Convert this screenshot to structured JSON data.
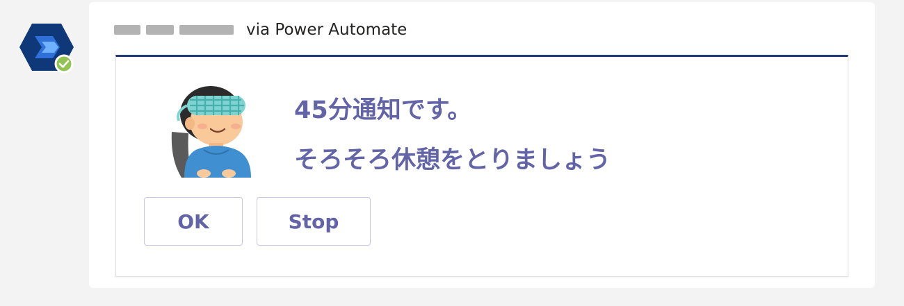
{
  "message": {
    "sender_suffix": "via Power Automate",
    "avatar_icon": "power-automate-icon",
    "status_icon": "available-check-icon"
  },
  "card": {
    "accent_color": "#1f3a73",
    "text_color": "#6264a7",
    "illustration_icon": "eye-mask-relax-illustration",
    "line1": "45分通知です。",
    "line2": "そろそろ休憩をとりましょう",
    "actions": {
      "ok_label": "OK",
      "stop_label": "Stop"
    }
  }
}
